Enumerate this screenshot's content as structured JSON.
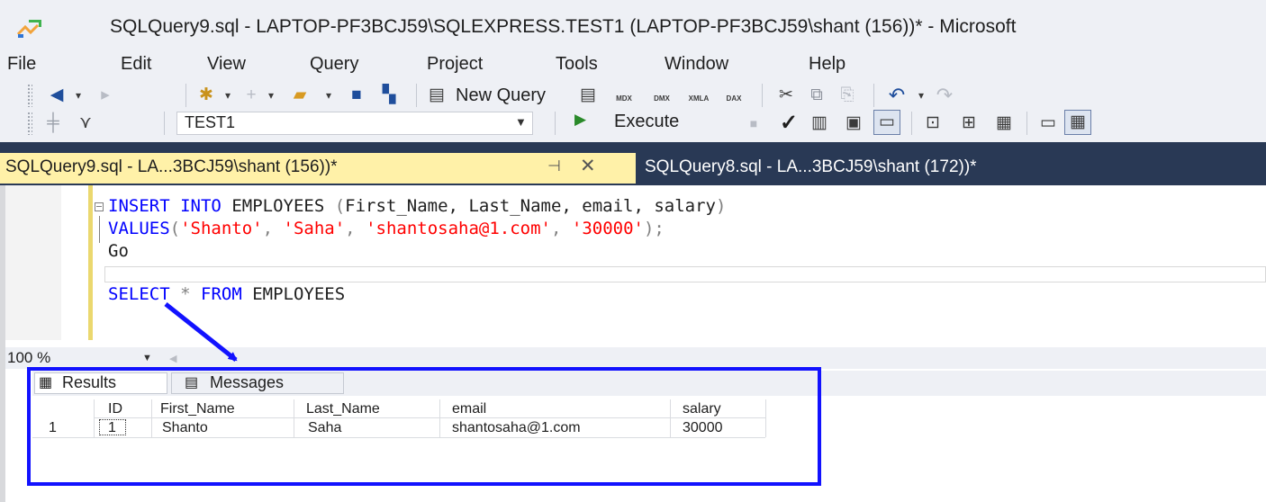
{
  "window": {
    "title": "SQLQuery9.sql - LAPTOP-PF3BCJ59\\SQLEXPRESS.TEST1 (LAPTOP-PF3BCJ59\\shant (156))* - Microsoft"
  },
  "menu": {
    "file": "File",
    "edit": "Edit",
    "view": "View",
    "query": "Query",
    "project": "Project",
    "tools": "Tools",
    "window": "Window",
    "help": "Help"
  },
  "toolbar": {
    "new_query_label": "New Query",
    "database": "TEST1",
    "execute_label": "Execute",
    "glyphs": {
      "back": "◀",
      "forward": "▸",
      "new_item": "✱",
      "add_item": "+",
      "open": "📂",
      "save": "💾",
      "save_all": "🗂",
      "new_query": "📄",
      "mdx": "MDX",
      "dmx": "DMX",
      "xmla": "XMLA",
      "dax": "DAX",
      "cut": "✂",
      "copy": "⧉",
      "paste": "⎘",
      "undo": "↶",
      "redo": "↷",
      "connect": "🔌",
      "change_connection": "⇄",
      "debug": "■",
      "parse": "✓",
      "plan": "⊞",
      "cancel": "▤",
      "results_text": "▭",
      "results_grid": "▦"
    }
  },
  "tabs": {
    "active": "SQLQuery9.sql - LA...3BCJ59\\shant (156))*",
    "pin": "⊣",
    "close": "✕",
    "inactive": "SQLQuery8.sql - LA...3BCJ59\\shant (172))*"
  },
  "editor": {
    "line1": {
      "insert": "INSERT",
      "into": "INTO",
      "table": "EMPLOYEES",
      "open_paren": "(",
      "columns": "First_Name, Last_Name, email, salary",
      "close_paren": ")"
    },
    "line2": {
      "values": "VALUES",
      "open_paren": "(",
      "v1": "'Shanto'",
      "c1": ",",
      "v2": "'Saha'",
      "c2": ",",
      "v3": "'shantosaha@1.com'",
      "c3": ",",
      "v4": "'30000'",
      "close": ");"
    },
    "line3": {
      "go": "Go"
    },
    "line5": {
      "select": "SELECT",
      "star": "*",
      "from": "FROM",
      "table": "EMPLOYEES"
    }
  },
  "zoom": {
    "level": "100 %",
    "dropdown": "▼",
    "scroll_left": "◀"
  },
  "results": {
    "tabs": {
      "results_icon": "▦",
      "results": "Results",
      "messages_icon": "▤",
      "messages": "Messages"
    },
    "columns": [
      "ID",
      "First_Name",
      "Last_Name",
      "email",
      "salary"
    ],
    "rows": [
      {
        "num": "1",
        "cells": [
          "1",
          "Shanto",
          "Saha",
          "shantosaha@1.com",
          "30000"
        ]
      }
    ]
  },
  "colors": {
    "arrow": "#1212ff",
    "highlight_border": "#1212ff",
    "active_tab": "#fff1a8",
    "tab_strip": "#293955",
    "keyword": "#0000ff",
    "string": "#ff0000"
  }
}
